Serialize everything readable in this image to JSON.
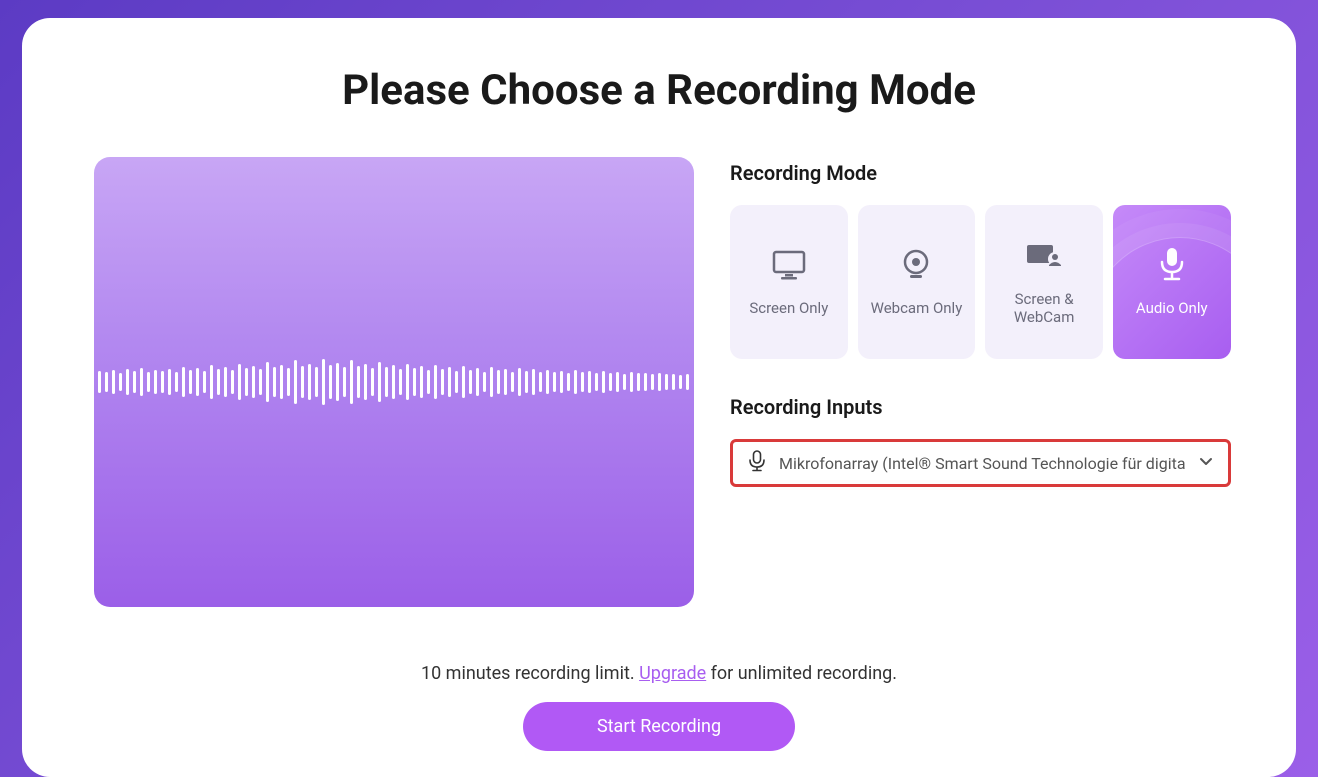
{
  "title": "Please Choose a Recording Mode",
  "sections": {
    "mode_label": "Recording Mode",
    "inputs_label": "Recording Inputs"
  },
  "modes": {
    "screen": "Screen Only",
    "webcam": "Webcam Only",
    "both": "Screen & WebCam",
    "audio": "Audio Only"
  },
  "input_device": "Mikrofonarray (Intel® Smart Sound Technologie für digita",
  "footer": {
    "limit_pre": "10 minutes recording limit.",
    "upgrade": "Upgrade",
    "limit_post": "for unlimited recording."
  },
  "start_button": "Start Recording"
}
